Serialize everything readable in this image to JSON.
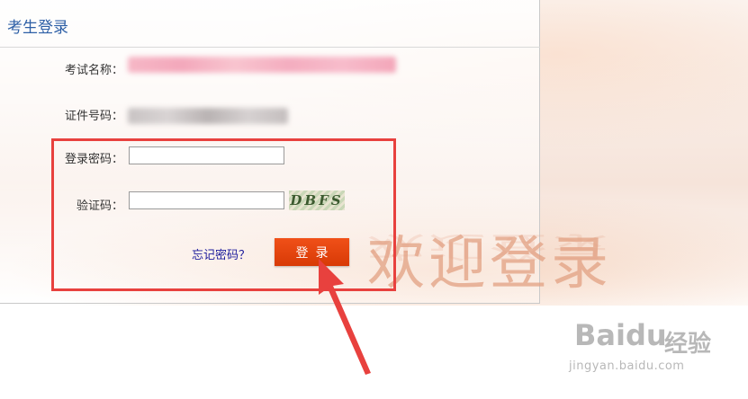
{
  "panel": {
    "title": "考生登录"
  },
  "form": {
    "exam_name_label": "考试名称：",
    "id_number_label": "证件号码：",
    "password_label": "登录密码：",
    "password_value": "",
    "captcha_label": "验证码：",
    "captcha_value": "",
    "captcha_text": "DBFS",
    "forgot_label": "忘记密码？",
    "login_label": "登录"
  },
  "decor": {
    "welcome_text": "欢迎登录"
  },
  "watermark": {
    "brand": "Baidu",
    "brand_cn": "经验",
    "url": "jingyan.baidu.com"
  },
  "colors": {
    "title": "#2d5fa6",
    "login_button": "#e8450f",
    "highlight_box": "#e8413e",
    "forgot_link": "#1c1c9c"
  }
}
